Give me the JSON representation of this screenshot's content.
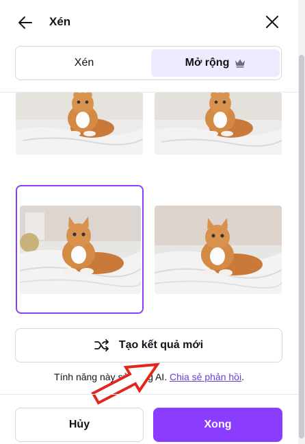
{
  "header": {
    "title": "Xén",
    "back_icon": "arrow-left-icon",
    "close_icon": "close-icon"
  },
  "tabs": [
    {
      "label": "Xén",
      "active": false
    },
    {
      "label": "Mở rộng",
      "active": true,
      "icon": "crown-icon"
    }
  ],
  "results": [
    {
      "name": "result-1",
      "selected": false
    },
    {
      "name": "result-2",
      "selected": false
    },
    {
      "name": "result-3",
      "selected": true
    },
    {
      "name": "result-4",
      "selected": false
    }
  ],
  "generate": {
    "label": "Tạo kết quả mới",
    "icon": "shuffle-icon"
  },
  "note": {
    "text": "Tính năng này sử dụng AI. ",
    "link": "Chia sẻ phản hồi",
    "suffix": "."
  },
  "footer": {
    "cancel_label": "Hủy",
    "done_label": "Xong"
  },
  "colors": {
    "accent": "#8b3dff",
    "tab_active_bg": "#efeafd",
    "annotation_arrow": "#e3261c"
  }
}
